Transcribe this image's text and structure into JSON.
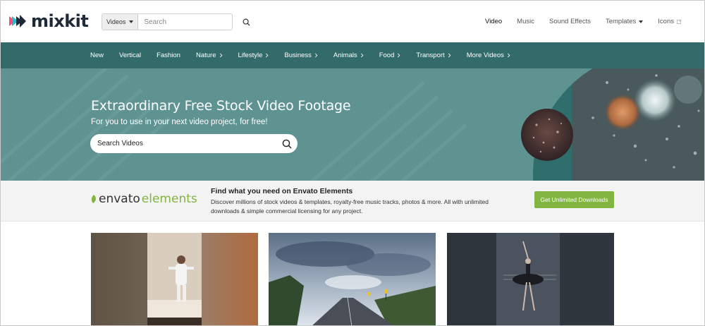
{
  "logo": {
    "text": "mixkit"
  },
  "search": {
    "category": "Videos",
    "placeholder": "Search"
  },
  "topnav": [
    {
      "label": "Video",
      "active": true
    },
    {
      "label": "Music",
      "active": false
    },
    {
      "label": "Sound Effects",
      "active": false
    },
    {
      "label": "Templates",
      "dropdown": true
    },
    {
      "label": "Icons",
      "external": true
    }
  ],
  "categories": [
    {
      "label": "New",
      "chevron": false
    },
    {
      "label": "Vertical",
      "chevron": false
    },
    {
      "label": "Fashion",
      "chevron": false
    },
    {
      "label": "Nature",
      "chevron": true
    },
    {
      "label": "Lifestyle",
      "chevron": true
    },
    {
      "label": "Business",
      "chevron": true
    },
    {
      "label": "Animals",
      "chevron": true
    },
    {
      "label": "Food",
      "chevron": true
    },
    {
      "label": "Transport",
      "chevron": true
    },
    {
      "label": "More Videos",
      "chevron": true
    }
  ],
  "hero": {
    "title": "Extraordinary Free Stock Video Footage",
    "subtitle": "For you to use in your next video project, for free!",
    "search_placeholder": "Search Videos"
  },
  "envato": {
    "logo_part1": "envato",
    "logo_part2": "elements",
    "title": "Find what you need on Envato Elements",
    "description": "Discover millions of stock videos & templates, royalty-free music tracks, photos & more. All with unlimited downloads & simple commercial licensing for any project.",
    "button": "Get Unlimited Downloads"
  },
  "colors": {
    "nav_bg": "#336b6b",
    "hero_bg": "#5f9392",
    "envato_green": "#82b541"
  },
  "icons": {
    "search": "search-icon",
    "chevron": "chevron-right-icon",
    "external": "external-link-icon"
  }
}
